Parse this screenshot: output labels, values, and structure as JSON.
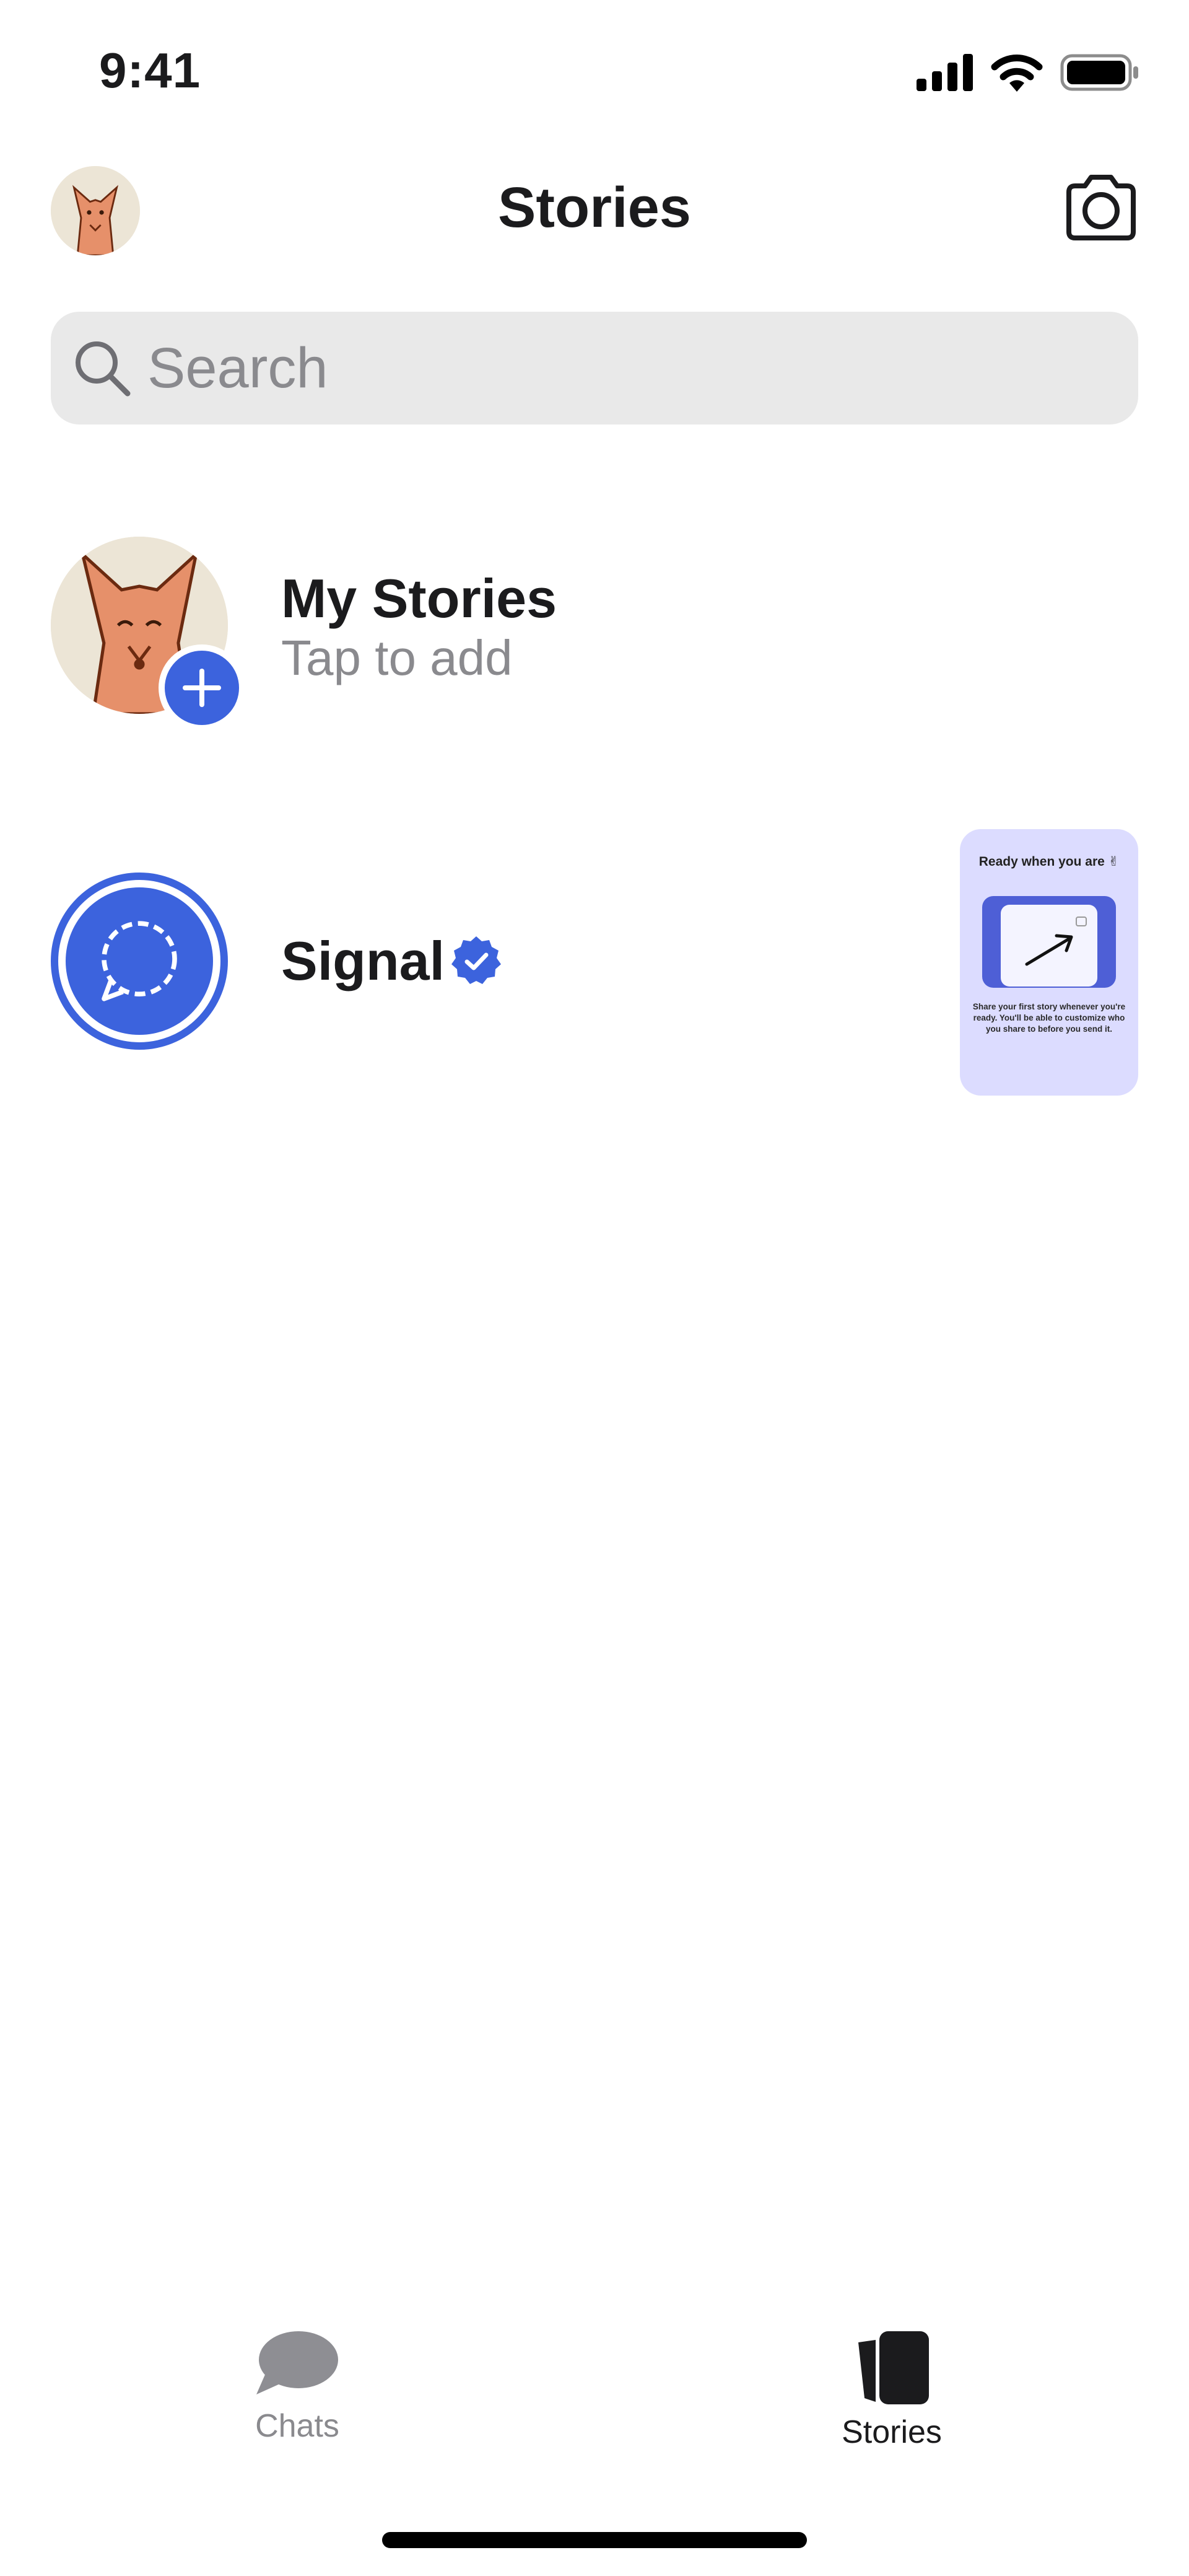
{
  "status_bar": {
    "time": "9:41"
  },
  "header": {
    "title": "Stories"
  },
  "search": {
    "placeholder": "Search"
  },
  "my_stories": {
    "title": "My Stories",
    "subtitle": "Tap to add"
  },
  "signal_story": {
    "name": "Signal",
    "verified": true,
    "thumbnail": {
      "title": "Ready when you are",
      "emoji": "✌",
      "body": "Share your first story whenever you're ready. You'll be able to customize who you share to before you send it."
    }
  },
  "tab_bar": {
    "tabs": [
      {
        "label": "Chats",
        "selected": false
      },
      {
        "label": "Stories",
        "selected": true
      }
    ]
  },
  "colors": {
    "accent": "#3c63dd",
    "muted": "#8a8a8e",
    "search_bg": "#e9e9e9",
    "avatar_bg": "#ece5d6",
    "fox": "#e6906a"
  }
}
